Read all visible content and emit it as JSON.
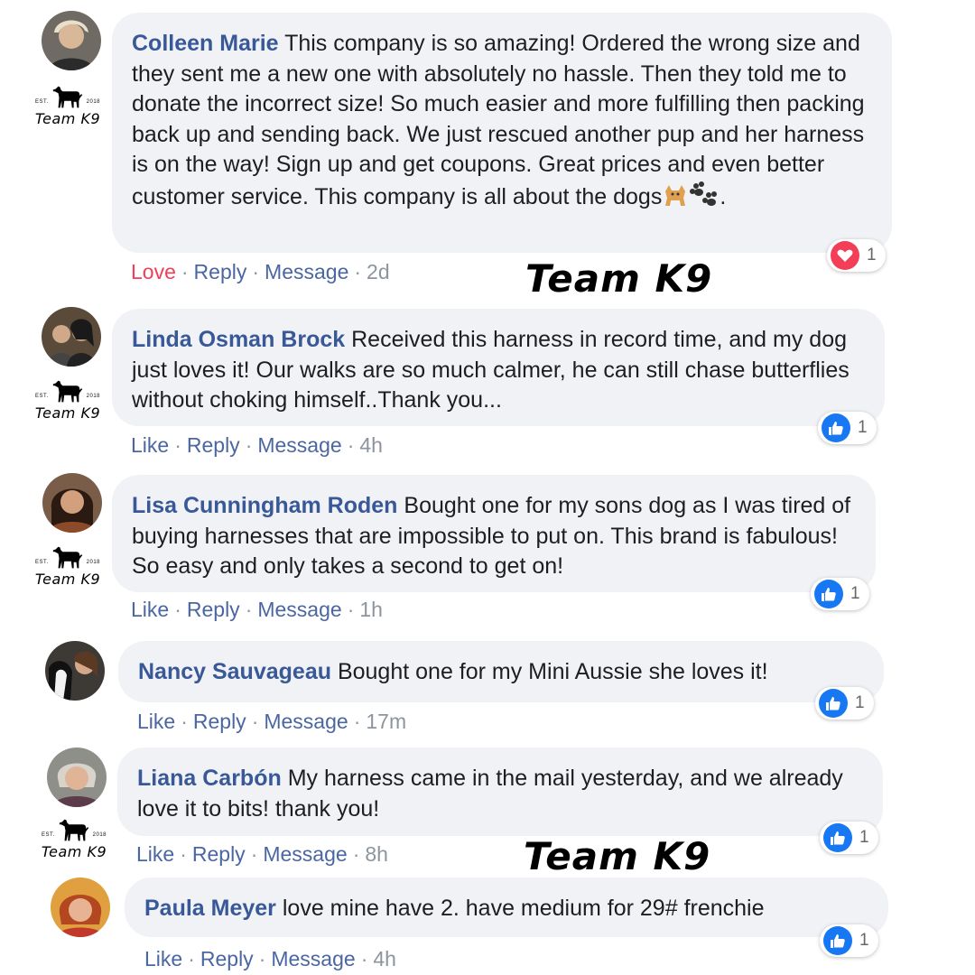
{
  "brand": {
    "est_left": "EST.",
    "est_right": "2018",
    "name": "Team K9"
  },
  "watermark": "Team K9",
  "colors": {
    "author": "#385898",
    "bubble": "#f0f2f5",
    "like_blue": "#1877f2",
    "love_red": "#f33e58"
  },
  "comments": [
    {
      "author": "Colleen Marie",
      "text": "This company is so amazing! Ordered the wrong size and they sent me a new one with absolutely no hassle. Then they told me to donate the incorrect size! So much easier and more fulfilling then packing back up and sending back. We just rescued another pup and her harness is on the way! Sign up and get coupons. Great prices and even better customer service. This company is all about the dogs",
      "text_end": ".",
      "emojis": [
        "dog-emoji",
        "paw-prints-emoji"
      ],
      "action_label": "Love",
      "reply": "Reply",
      "message": "Message",
      "time": "2d",
      "reaction_icon": "heart-icon",
      "reaction_count": "1"
    },
    {
      "author": "Linda Osman Brock",
      "text": "Received this harness in record time, and my dog just loves it! Our walks are so much calmer, he can still chase butterflies without choking himself..Thank you...",
      "action_label": "Like",
      "reply": "Reply",
      "message": "Message",
      "time": "4h",
      "reaction_icon": "thumbs-up-icon",
      "reaction_count": "1"
    },
    {
      "author": "Lisa Cunningham Roden",
      "text": "Bought one for my sons dog as I was tired of buying harnesses that are impossible to put on. This brand is fabulous! So easy and only takes a second to get on!",
      "action_label": "Like",
      "reply": "Reply",
      "message": "Message",
      "time": "1h",
      "reaction_icon": "thumbs-up-icon",
      "reaction_count": "1"
    },
    {
      "author": "Nancy Sauvageau",
      "text": "Bought one for my Mini Aussie she loves it!",
      "action_label": "Like",
      "reply": "Reply",
      "message": "Message",
      "time": "17m",
      "reaction_icon": "thumbs-up-icon",
      "reaction_count": "1"
    },
    {
      "author": "Liana Carbón",
      "text": "My harness came in the mail yesterday, and we already love it to bits! thank you!",
      "action_label": "Like",
      "reply": "Reply",
      "message": "Message",
      "time": "8h",
      "reaction_icon": "thumbs-up-icon",
      "reaction_count": "1"
    },
    {
      "author": "Paula Meyer",
      "text": "love mine have 2. have medium for 29# frenchie",
      "action_label": "Like",
      "reply": "Reply",
      "message": "Message",
      "time": "4h",
      "reaction_icon": "thumbs-up-icon",
      "reaction_count": "1"
    }
  ]
}
